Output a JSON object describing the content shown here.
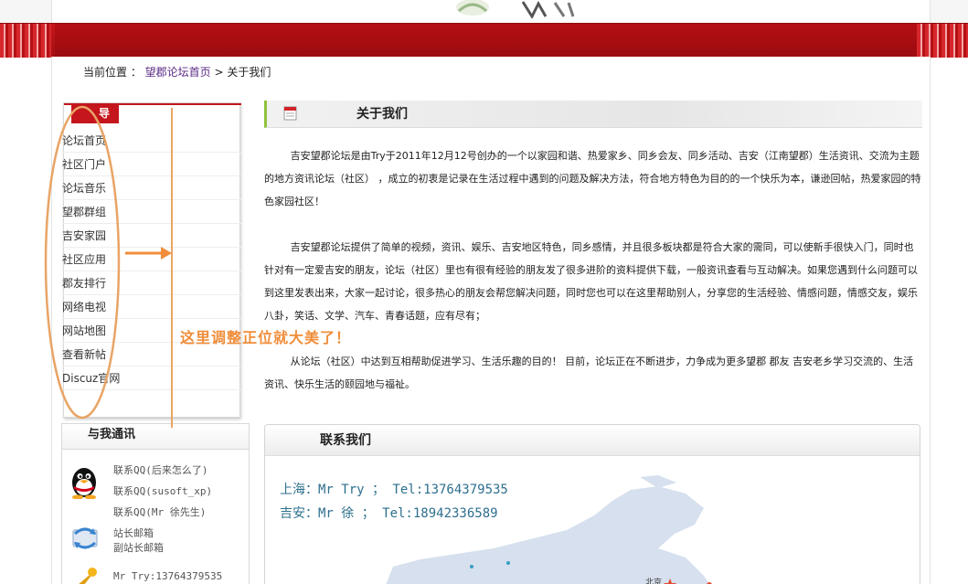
{
  "breadcrumb": {
    "label": "当前位置 ：",
    "home": "望郡论坛首页",
    "sep": ">",
    "current": "关于我们"
  },
  "nav": {
    "title": "导航",
    "items": [
      "论坛首页",
      "社区门户",
      "论坛音乐",
      "望郡群组",
      "吉安家园",
      "社区应用",
      "郡友排行",
      "网络电视",
      "网站地图",
      "查看新帖",
      "Discuz官网"
    ]
  },
  "contact_sidebar": {
    "title": "与我通讯",
    "qq": [
      "联系QQ(后来怎么了)",
      "联系QQ(susoft_xp)",
      "联系QQ(Mr 徐先生)"
    ],
    "mail": [
      "站长邮箱",
      "副站长邮箱"
    ],
    "phone": "Mr Try:13764379535"
  },
  "about": {
    "title": "关于我们",
    "paragraphs": [
      "吉安望郡论坛是由Try于2011年12月12号创办的一个以家园和谐、热爱家乡、同乡会友、同乡活动、吉安（江南望郡）生活资讯、交流为主题的地方资讯论坛（社区） ，成立的初衷是记录在生活过程中遇到的问题及解决方法，符合地方特色为目的的一个快乐为本，谦逊回帖，热爱家园的特色家园社区！",
      "吉安望郡论坛提供了简单的视频，资讯、娱乐、吉安地区特色，同乡感情，并且很多板块都是符合大家的需同，可以使新手很快入门，同时也针对有一定爱吉安的朋友，论坛（社区）里也有很有经验的朋友发了很多进阶的资料提供下载，一般资讯查看与互动解决。如果您遇到什么问题可以到这里发表出来，大家一起讨论，很多热心的朋友会帮您解决问题，同时您也可以在这里帮助别人，分享您的生活经验、情感问题，情感交友，娱乐八卦，笑话、文学、汽车、青春话题，应有尽有；",
      "从论坛（社区）中达到互相帮助促进学习、生活乐趣的目的！ 目前，论坛正在不断进步，力争成为更多望郡 郡友 吉安老乡学习交流的、生活资讯、快乐生活的颐园地与福祉。"
    ]
  },
  "contact_us": {
    "title": "联系我们",
    "lines": [
      "上海：Mr Try ； Tel:13764379535",
      "吉安：Mr 徐  ； Tel:18942336589"
    ],
    "map_label": "北京"
  },
  "annotation": {
    "text": "这里调整正位就大美了！",
    "color": "#f08d3a"
  },
  "colors": {
    "brand_red": "#c4161c",
    "link_purple": "#5a2a86",
    "contact_blue": "#2d6f8e"
  }
}
